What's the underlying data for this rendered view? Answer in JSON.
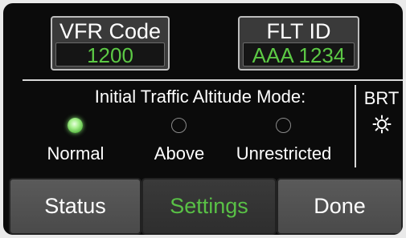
{
  "vfr": {
    "label": "VFR Code",
    "value": "1200"
  },
  "flt_id": {
    "label": "FLT ID",
    "value": "AAA 1234"
  },
  "altitude_mode": {
    "title": "Initial Traffic Altitude Mode:",
    "options": [
      {
        "label": "Normal",
        "selected": true
      },
      {
        "label": "Above",
        "selected": false
      },
      {
        "label": "Unrestricted",
        "selected": false
      }
    ]
  },
  "brightness": {
    "label": "BRT",
    "icon": "sun-icon"
  },
  "bottom_bar": {
    "status_label": "Status",
    "settings_label": "Settings",
    "done_label": "Done"
  },
  "colors": {
    "background": "#0b0b0b",
    "value_text": "#5cc945",
    "active_tab": "#59c146",
    "button": "#555555"
  }
}
